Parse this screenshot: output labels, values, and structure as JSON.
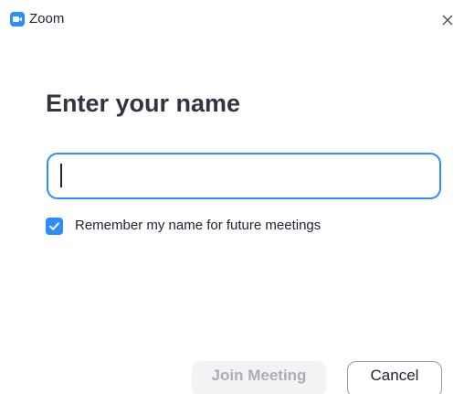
{
  "window": {
    "title": "Zoom",
    "app_icon": "zoom-camera-icon",
    "close_icon": "close-icon"
  },
  "dialog": {
    "heading": "Enter your name",
    "name_input": {
      "value": "",
      "placeholder": ""
    },
    "remember": {
      "label": "Remember my name for future meetings",
      "checked": true
    },
    "buttons": {
      "join_label": "Join Meeting",
      "join_enabled": false,
      "cancel_label": "Cancel"
    }
  },
  "colors": {
    "accent": "#2d8cff",
    "text": "#232333",
    "disabled_text": "#adadb7",
    "disabled_bg": "#f3f3f5"
  }
}
